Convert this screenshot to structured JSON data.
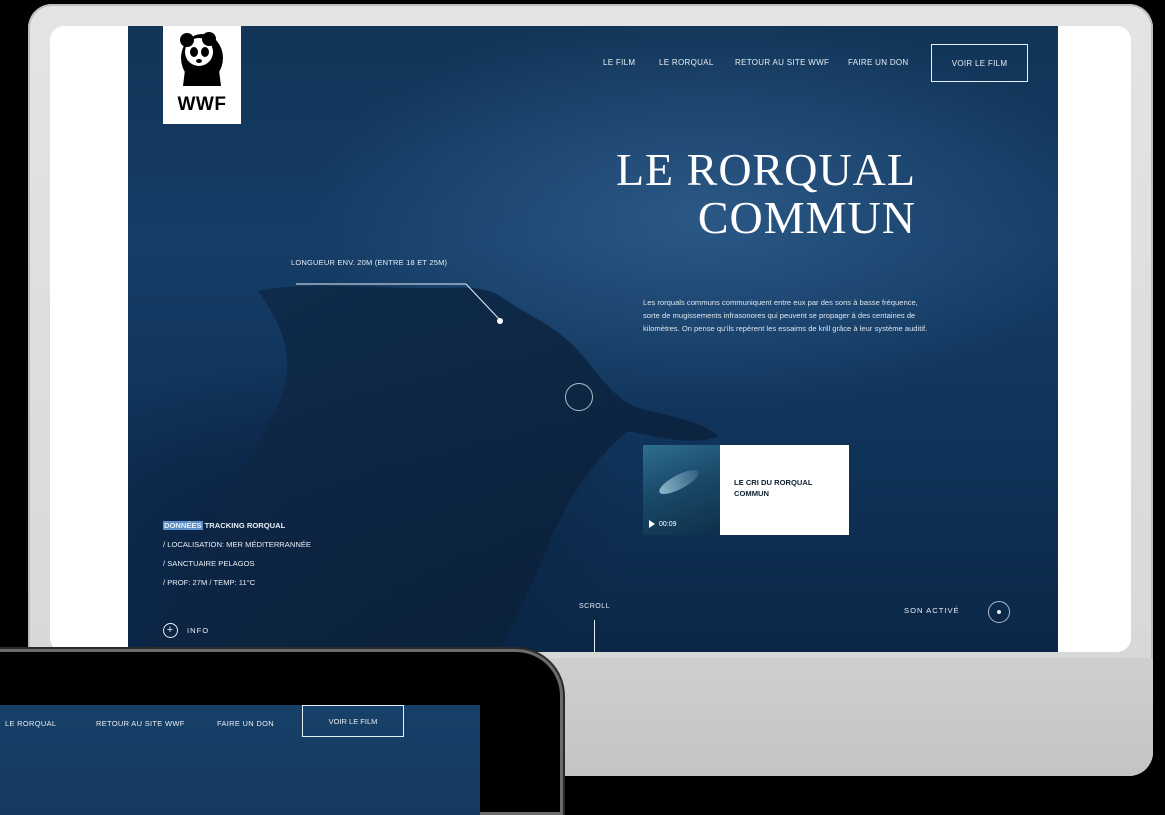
{
  "brand": {
    "logo_text": "WWF"
  },
  "nav": {
    "items": [
      "LE FILM",
      "LE RORQUAL",
      "RETOUR AU SITE WWF",
      "FAIRE UN DON"
    ],
    "cta": "VOIR LE FILM"
  },
  "hero": {
    "title_line1": "LE RORQUAL",
    "title_line2": "COMMUN",
    "length_label": "LONGUEUR ENV. 20M (ENTRE 18 ET 25M)",
    "description": "Les rorquals communs communiquent entre eux par des sons à basse fréquence, sorte de mugissements infrasonores qui peuvent se propager à des centaines de kilomètres. On pense qu'ils repèrent les essaims de krill grâce à leur système auditif."
  },
  "video": {
    "title": "LE CRI DU RORQUAL COMMUN",
    "duration": "00:09"
  },
  "tracking": {
    "title_highlight": "DONNÉES",
    "title_rest": " TRACKING RORQUAL",
    "lines": [
      "/ LOCALISATION: MER MÉDITERRANNÉE",
      "/ SANCTUAIRE PELAGOS",
      "/ PROF: 27M / TEMP: 11°C"
    ]
  },
  "info_label": "INFO",
  "scroll_label": "SCROLL",
  "sound_label": "SON ACTIVÉ",
  "tablet": {
    "nav_items": [
      "LE RORQUAL",
      "RETOUR AU SITE WWF",
      "FAIRE UN DON"
    ],
    "cta": "VOIR LE FILM"
  },
  "icons": {
    "brand": "panda-logo-icon",
    "play": "play-icon",
    "info": "plus-circle-icon",
    "sound": "sound-dot-icon"
  }
}
